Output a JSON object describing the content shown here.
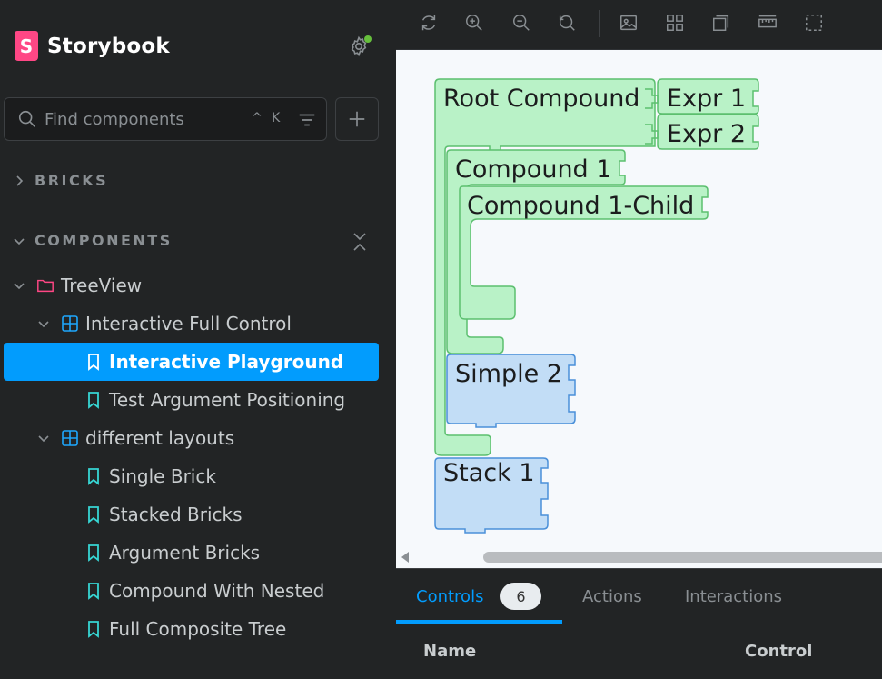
{
  "app": {
    "title": "Storybook"
  },
  "search": {
    "placeholder": "Find components",
    "shortcut": "^ K"
  },
  "sections": {
    "bricks": "BRICKS",
    "components": "COMPONENTS"
  },
  "tree": {
    "folder": "TreeView",
    "groups": [
      {
        "label": "Interactive Full Control",
        "stories": [
          "Interactive Playground",
          "Test Argument Positioning"
        ]
      },
      {
        "label": "different layouts",
        "stories": [
          "Single Brick",
          "Stacked Bricks",
          "Argument Bricks",
          "Compound With Nested",
          "Full Composite Tree"
        ]
      }
    ]
  },
  "canvas": {
    "bricks": {
      "root": "Root Compound",
      "expr1": "Expr 1",
      "expr2": "Expr 2",
      "compound1": "Compound 1",
      "compound1child": "Compound 1-Child",
      "simple2": "Simple 2",
      "stack1": "Stack 1"
    }
  },
  "addons": {
    "tabs": {
      "controls": "Controls",
      "controls_count": "6",
      "actions": "Actions",
      "interactions": "Interactions"
    },
    "table": {
      "name": "Name",
      "control": "Control"
    }
  },
  "colors": {
    "accent": "#029cfd",
    "brand": "#ff4785",
    "green_brick": "#b9f2c7",
    "blue_brick": "#c2ddf6"
  }
}
